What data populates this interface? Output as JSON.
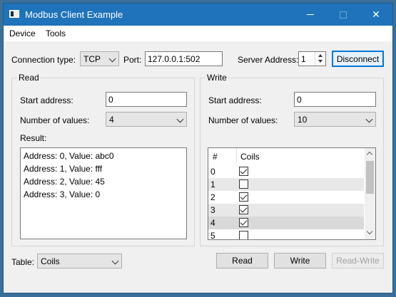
{
  "window": {
    "title": "Modbus Client Example"
  },
  "menu": [
    "Device",
    "Tools"
  ],
  "connection": {
    "type_label": "Connection type:",
    "type_value": "TCP",
    "port_label": "Port:",
    "port_value": "127.0.0.1:502",
    "server_label": "Server Address:",
    "server_value": "1",
    "disconnect_label": "Disconnect"
  },
  "read": {
    "title": "Read",
    "start_label": "Start address:",
    "start_value": "0",
    "count_label": "Number of values:",
    "count_value": "4",
    "result_label": "Result:",
    "results": [
      "Address: 0, Value: abc0",
      "Address: 1, Value: fff",
      "Address: 2, Value: 45",
      "Address: 3, Value: 0"
    ]
  },
  "write": {
    "title": "Write",
    "start_label": "Start address:",
    "start_value": "0",
    "count_label": "Number of values:",
    "count_value": "10",
    "table_headers": [
      "#",
      "Coils"
    ],
    "rows": [
      {
        "num": "0",
        "checked": true
      },
      {
        "num": "1",
        "checked": false
      },
      {
        "num": "2",
        "checked": true
      },
      {
        "num": "3",
        "checked": true
      },
      {
        "num": "4",
        "checked": true
      },
      {
        "num": "5",
        "checked": false
      }
    ]
  },
  "bottom": {
    "table_label": "Table:",
    "table_value": "Coils",
    "read_label": "Read",
    "write_label": "Write",
    "readwrite_label": "Read-Write"
  }
}
